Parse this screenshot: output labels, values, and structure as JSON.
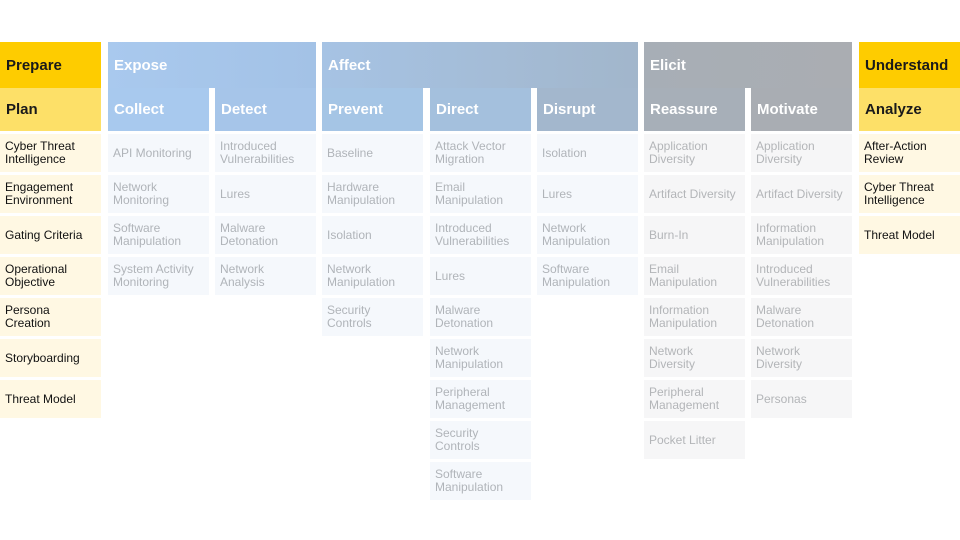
{
  "tactics": [
    {
      "label": "Prepare",
      "color": "#fecc00"
    },
    {
      "label": "Expose",
      "color": "#a7c6ea"
    },
    {
      "label": "Affect",
      "color": "#a5bcd6"
    },
    {
      "label": "Elicit",
      "color": "#a8adb4"
    },
    {
      "label": "Understand",
      "color": "#fecc00"
    }
  ],
  "techniques": [
    {
      "label": "Plan",
      "color": "#fde068",
      "items": [
        "Cyber Threat Intelligence",
        "Engagement Environment",
        "Gating Criteria",
        "Operational Objective",
        "Persona Creation",
        "Storyboarding",
        "Threat Model"
      ]
    },
    {
      "label": "Collect",
      "color": "#a7c9ec",
      "items": [
        "API Monitoring",
        "Network Monitoring",
        "Software Manipulation",
        "System Activity Monitoring"
      ]
    },
    {
      "label": "Detect",
      "color": "#a6c5e8",
      "items": [
        "Introduced Vulnerabilities",
        "Lures",
        "Malware Detonation",
        "Network Analysis"
      ]
    },
    {
      "label": "Prevent",
      "color": "#a4c4e3",
      "items": [
        "Baseline",
        "Hardware Manipulation",
        "Isolation",
        "Network Manipulation",
        "Security Controls"
      ]
    },
    {
      "label": "Direct",
      "color": "#a4c0dc",
      "items": [
        "Attack Vector Migration",
        "Email Manipulation",
        "Introduced Vulnerabilities",
        "Lures",
        "Malware Detonation",
        "Network Manipulation",
        "Peripheral Management",
        "Security Controls",
        "Software Manipulation"
      ]
    },
    {
      "label": "Disrupt",
      "color": "#a3b7cc",
      "items": [
        "Isolation",
        "Lures",
        "Network Manipulation",
        "Software Manipulation"
      ]
    },
    {
      "label": "Reassure",
      "color": "#a7afb8",
      "items": [
        "Application Diversity",
        "Artifact Diversity",
        "Burn-In",
        "Email Manipulation",
        "Information Manipulation",
        "Network Diversity",
        "Peripheral Management",
        "Pocket Litter"
      ]
    },
    {
      "label": "Motivate",
      "color": "#a9adb3",
      "items": [
        "Application Diversity",
        "Artifact Diversity",
        "Information Manipulation",
        "Introduced Vulnerabilities",
        "Malware Detonation",
        "Network Diversity",
        "Personas"
      ]
    },
    {
      "label": "Analyze",
      "color": "#fde068",
      "items": [
        "After-Action Review",
        "Cyber Threat Intelligence",
        "Threat Model"
      ]
    }
  ]
}
